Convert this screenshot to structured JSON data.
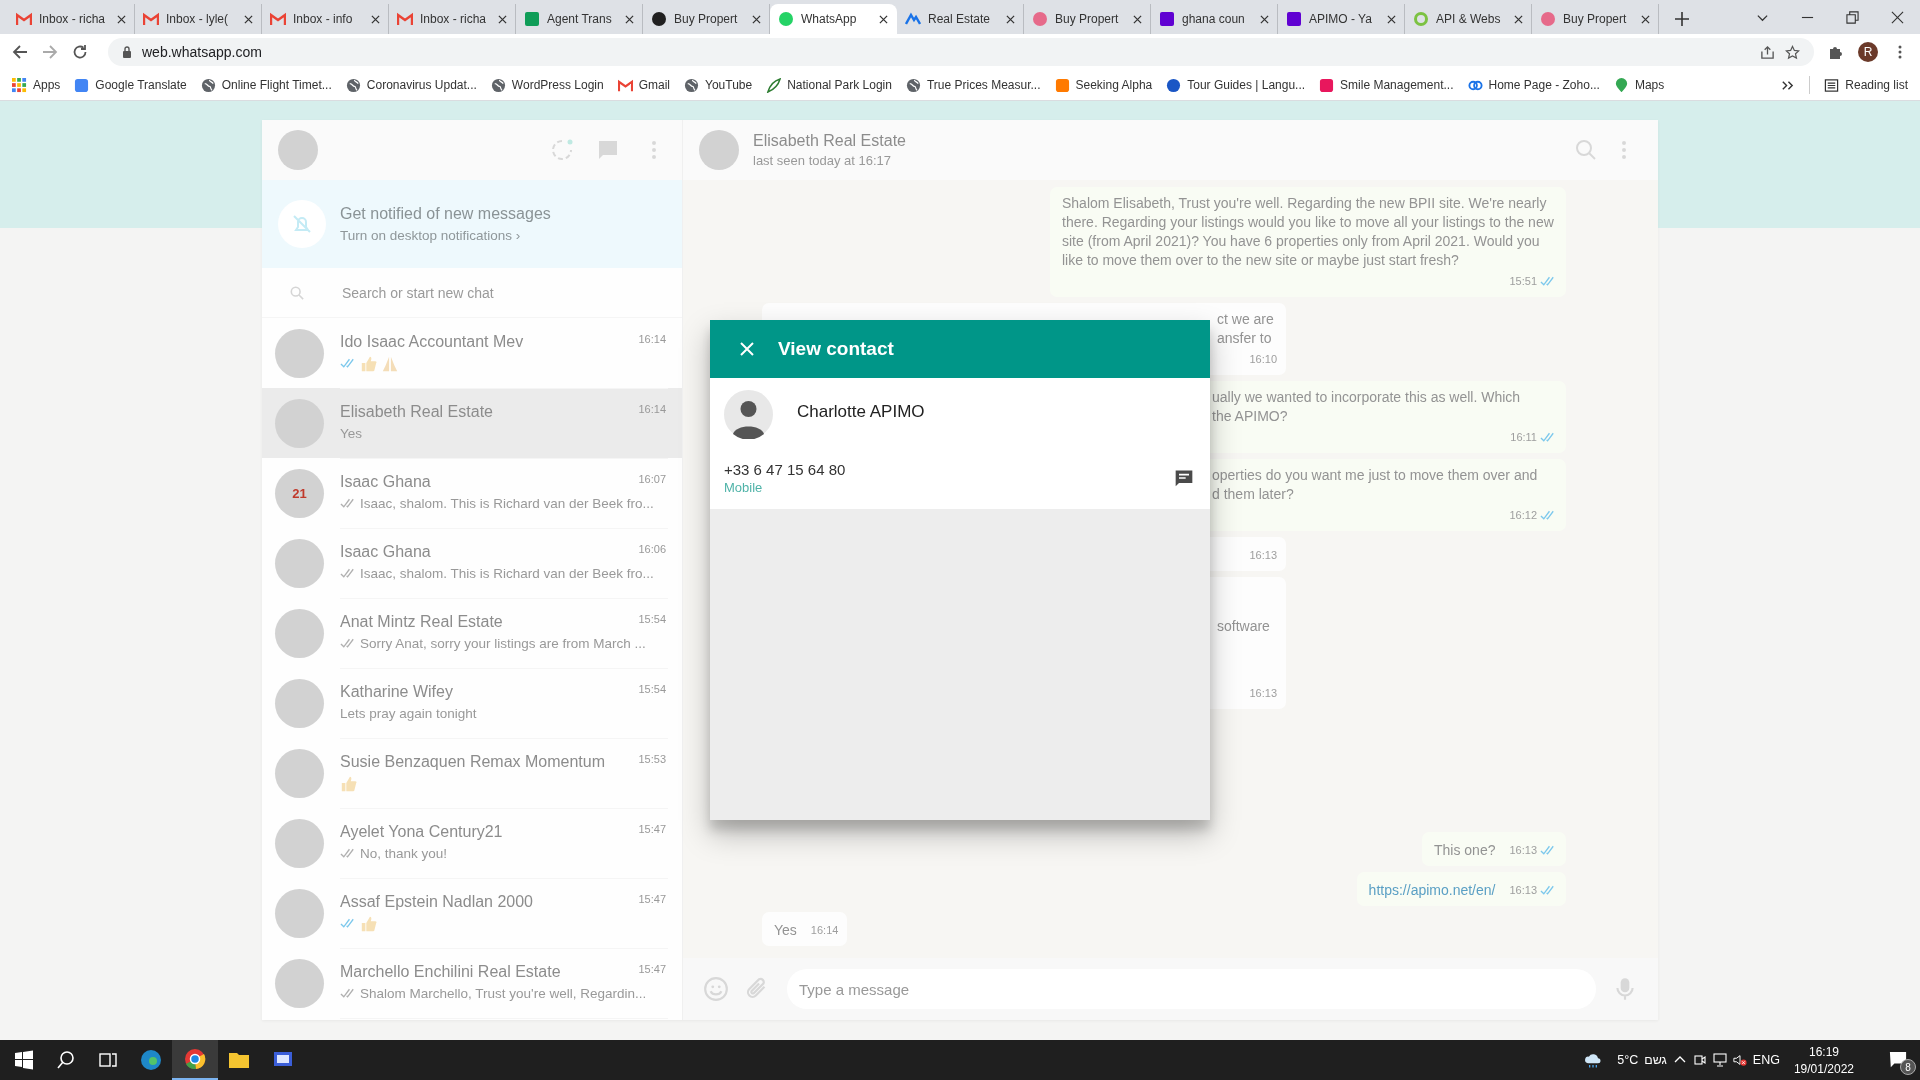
{
  "browser": {
    "tabs": [
      {
        "title": "Inbox - richa",
        "kind": "gmail",
        "selected": false
      },
      {
        "title": "Inbox - lyle(",
        "kind": "gmail",
        "selected": false
      },
      {
        "title": "Inbox - info",
        "kind": "gmail",
        "selected": false
      },
      {
        "title": "Inbox - richa",
        "kind": "gmail",
        "selected": false
      },
      {
        "title": "Agent Trans",
        "kind": "sheets",
        "selected": false
      },
      {
        "title": "Buy Propert",
        "kind": "dark",
        "selected": false
      },
      {
        "title": "WhatsApp",
        "kind": "whatsapp",
        "selected": true
      },
      {
        "title": "Real Estate",
        "kind": "wing",
        "selected": false
      },
      {
        "title": "Buy Propert",
        "kind": "house",
        "selected": false
      },
      {
        "title": "ghana coun",
        "kind": "yahoo",
        "selected": false
      },
      {
        "title": "APIMO - Ya",
        "kind": "yahoo",
        "selected": false
      },
      {
        "title": "API & Webs",
        "kind": "ring",
        "selected": false
      },
      {
        "title": "Buy Propert",
        "kind": "house",
        "selected": false
      }
    ],
    "url": "web.whatsapp.com",
    "profile_initial": "R",
    "bookmarks": [
      {
        "label": "Apps",
        "kind": "grid"
      },
      {
        "label": "Google Translate",
        "kind": "translate"
      },
      {
        "label": "Online Flight Timet...",
        "kind": "globe"
      },
      {
        "label": "Coronavirus Updat...",
        "kind": "globe"
      },
      {
        "label": "WordPress Login",
        "kind": "globe"
      },
      {
        "label": "Gmail",
        "kind": "gmail"
      },
      {
        "label": "YouTube",
        "kind": "globe"
      },
      {
        "label": "National Park Login",
        "kind": "leaf"
      },
      {
        "label": "True Prices Measur...",
        "kind": "globe"
      },
      {
        "label": "Seeking Alpha",
        "kind": "alpha"
      },
      {
        "label": "Tour Guides | Langu...",
        "kind": "info"
      },
      {
        "label": "Smile Management...",
        "kind": "smile"
      },
      {
        "label": "Home Page - Zoho...",
        "kind": "rings"
      },
      {
        "label": "Maps",
        "kind": "pin"
      }
    ],
    "reading_list": "Reading list"
  },
  "sidebar": {
    "notice": {
      "title": "Get notified of new messages",
      "action": "Turn on desktop notifications ›"
    },
    "search": {
      "placeholder": "Search or start new chat"
    },
    "chats": [
      {
        "name": "Ido Isaac Accountant Mev",
        "time": "16:14",
        "read": true,
        "emojis": [
          {
            "kind": "thumbs"
          },
          {
            "kind": "pray"
          }
        ],
        "selected": false
      },
      {
        "name": "Elisabeth Real Estate",
        "time": "16:14",
        "preview": "Yes",
        "selected": true
      },
      {
        "name": "Isaac Ghana",
        "time": "16:07",
        "read": false,
        "preview": "Isaac, shalom. This is Richard van der Beek fro...",
        "avatar_text": "21",
        "selected": false
      },
      {
        "name": "Isaac Ghana",
        "time": "16:06",
        "read": false,
        "preview": "Isaac, shalom. This is Richard van der Beek fro...",
        "selected": false
      },
      {
        "name": "Anat Mintz Real Estate",
        "time": "15:54",
        "read": false,
        "preview": "Sorry Anat, sorry your listings are from March ...",
        "selected": false
      },
      {
        "name": "Katharine Wifey",
        "time": "15:54",
        "preview": "Lets pray again tonight",
        "selected": false
      },
      {
        "name": "Susie Benzaquen Remax Momentum",
        "time": "15:53",
        "emojis": [
          {
            "kind": "thumbs"
          }
        ],
        "selected": false
      },
      {
        "name": "Ayelet Yona Century21",
        "time": "15:47",
        "read": false,
        "preview": "No, thank you!",
        "selected": false
      },
      {
        "name": "Assaf Epstein Nadlan 2000",
        "time": "15:47",
        "read": true,
        "emojis": [
          {
            "kind": "thumbs"
          }
        ],
        "selected": false
      },
      {
        "name": "Marchello Enchilini Real Estate",
        "time": "15:47",
        "read": false,
        "preview": "Shalom Marchello, Trust you're well, Regardin...",
        "selected": false
      }
    ]
  },
  "chat": {
    "name": "Elisabeth Real Estate",
    "status": "last seen today at 16:17",
    "messages": [
      {
        "kind": "out",
        "lines": [
          "Shalom Elisabeth, Trust you're well. Regarding the new BPII site. We're nearly there. Regarding your listings would you like to move all your listings to the new site (from April 2021)? You have 6 properties only from April 2021. Would you like to move them over to the new site or maybe just start fresh?"
        ],
        "time": "15:51",
        "read": true,
        "covered": false
      },
      {
        "kind": "in",
        "lines": [
          "ct we are",
          "ansfer to"
        ],
        "time": "16:10",
        "covered": true
      },
      {
        "kind": "out",
        "lines": [
          "ually we wanted to incorporate this as well. Which",
          "the APIMO?"
        ],
        "time": "16:11",
        "read": true,
        "covered": true
      },
      {
        "kind": "out",
        "lines": [
          "operties do you want me just to move them over and",
          "d them later?"
        ],
        "time": "16:12",
        "read": true,
        "covered": true
      },
      {
        "kind": "in",
        "time": "16:13",
        "covered": true
      },
      {
        "kind": "in",
        "lines": [
          "software"
        ],
        "time": "16:13",
        "covered": true,
        "tall": true
      }
    ],
    "recent_messages": [
      {
        "kind": "out",
        "lines": [
          "This one?"
        ],
        "time": "16:13",
        "read": true,
        "covered": false
      },
      {
        "kind": "link",
        "lines": [
          "https://apimo.net/en/"
        ],
        "time": "16:13",
        "read": true,
        "covered": false
      },
      {
        "kind": "in",
        "lines": [
          "Yes"
        ],
        "time": "16:14",
        "covered": false
      }
    ],
    "composer": {
      "placeholder": "Type a message"
    }
  },
  "dialog": {
    "title": "View contact",
    "contact": {
      "name": "Charlotte APIMO",
      "phone": "+33 6 47 15 64 80",
      "phone_type": "Mobile"
    }
  },
  "taskbar": {
    "apps": [
      {
        "kind": "edge",
        "selected": false
      },
      {
        "kind": "chrome",
        "selected": true
      },
      {
        "kind": "folder",
        "selected": false
      },
      {
        "kind": "app",
        "selected": false
      }
    ],
    "temperature": "5°C",
    "weather": "גשם",
    "language": "ENG",
    "time": "16:19",
    "date": "19/01/2022",
    "notifications": "8"
  }
}
